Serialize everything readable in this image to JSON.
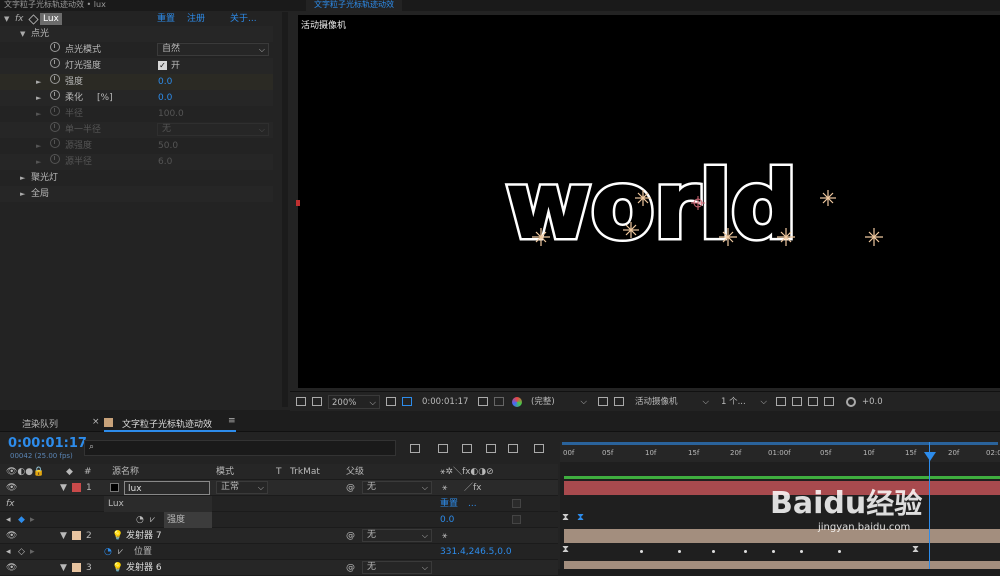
{
  "effect_controls": {
    "title": "文字粒子光标轨迹动效 • lux",
    "effect": {
      "name": "Lux",
      "reset": "重置",
      "register": "注册",
      "about": "关于..."
    },
    "rows": [
      {
        "label": "点光"
      },
      {
        "label": "点光模式",
        "value": "自然"
      },
      {
        "label": "灯光强度",
        "value": "开"
      },
      {
        "label": "强度",
        "value": "0.0"
      },
      {
        "label": "柔化",
        "unit": "[%]",
        "value": "0.0"
      },
      {
        "label": "半径",
        "value": "100.0"
      },
      {
        "label": "单一半径",
        "value": "无"
      },
      {
        "label": "源强度",
        "value": "50.0"
      },
      {
        "label": "源半径",
        "value": "6.0"
      },
      {
        "label": "聚光灯"
      },
      {
        "label": "全局"
      }
    ]
  },
  "viewer": {
    "tab": "文字粒子光标轨迹动效",
    "camera_label": "活动摄像机",
    "canvas_text": "world",
    "toolbar": {
      "zoom": "200%",
      "timecode": "0:00:01:17",
      "resolution": "(完整)",
      "camera": "活动摄像机",
      "views": "1 个...",
      "exposure": "+0.0"
    }
  },
  "timeline": {
    "tabs": {
      "render_queue": "渲染队列",
      "comp": "文字粒子光标轨迹动效"
    },
    "timecode": "0:00:01:17",
    "frame_info": "00042 (25.00 fps)",
    "search_placeholder": "",
    "headers": {
      "source_name": "源名称",
      "mode": "模式",
      "t": "T",
      "trkmat": "TrkMat",
      "parent": "父级"
    },
    "ruler_ticks": [
      "00f",
      "05f",
      "10f",
      "15f",
      "20f",
      "01:00f",
      "05f",
      "10f",
      "15f",
      "20f",
      "02:0"
    ],
    "playhead_frame": 42,
    "layers": [
      {
        "num": "1",
        "name": "lux",
        "mode": "正常",
        "parent": "无",
        "color": "#c94a4a"
      },
      {
        "effect": "Lux",
        "reset": "重置",
        "more": "..."
      },
      {
        "property": "强度",
        "value": "0.0"
      },
      {
        "num": "2",
        "name": "发射器 7",
        "parent": "无",
        "color": "#e8c4a0"
      },
      {
        "property": "位置",
        "value": "331.4,246.5,0.0"
      },
      {
        "num": "3",
        "name": "发射器 6",
        "parent": "无",
        "color": "#e8c4a0"
      }
    ]
  },
  "watermark": {
    "brand": "Baidu",
    "cn": "经验",
    "url": "jingyan.baidu.com"
  },
  "colors": {
    "accent": "#2d8ceb",
    "layer_red": "#a84a4e",
    "layer_tan": "#a38e7e"
  }
}
